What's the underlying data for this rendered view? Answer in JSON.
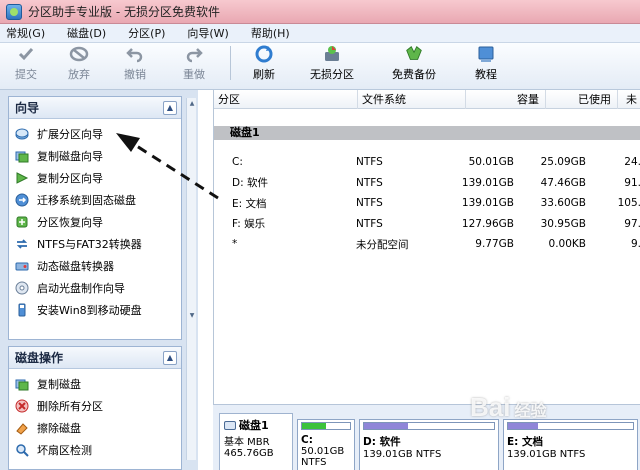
{
  "window": {
    "title": "分区助手专业版 - 无损分区免费软件"
  },
  "menu": [
    {
      "label": "常规(G)"
    },
    {
      "label": "磁盘(D)"
    },
    {
      "label": "分区(P)"
    },
    {
      "label": "向导(W)"
    },
    {
      "label": "帮助(H)"
    }
  ],
  "toolbar": {
    "submit": "提交",
    "discard": "放弃",
    "undo": "撤销",
    "redo": "重做",
    "refresh": "刷新",
    "lossless": "无损分区",
    "backup": "免费备份",
    "tutorial": "教程"
  },
  "wizard_panel": {
    "title": "向导",
    "items": [
      {
        "label": "扩展分区向导",
        "icon": "expand-partition-icon"
      },
      {
        "label": "复制磁盘向导",
        "icon": "copy-disk-icon"
      },
      {
        "label": "复制分区向导",
        "icon": "copy-partition-icon"
      },
      {
        "label": "迁移系统到固态磁盘",
        "icon": "migrate-ssd-icon"
      },
      {
        "label": "分区恢复向导",
        "icon": "recovery-icon"
      },
      {
        "label": "NTFS与FAT32转换器",
        "icon": "convert-icon"
      },
      {
        "label": "动态磁盘转换器",
        "icon": "dynamic-disk-icon"
      },
      {
        "label": "启动光盘制作向导",
        "icon": "boot-cd-icon"
      },
      {
        "label": "安装Win8到移动硬盘",
        "icon": "win8-usb-icon"
      }
    ]
  },
  "disk_ops_panel": {
    "title": "磁盘操作",
    "items": [
      {
        "label": "复制磁盘",
        "icon": "copy-disk-icon"
      },
      {
        "label": "删除所有分区",
        "icon": "delete-all-icon"
      },
      {
        "label": "擦除磁盘",
        "icon": "wipe-disk-icon"
      },
      {
        "label": "坏扇区检测",
        "icon": "bad-sector-icon"
      }
    ]
  },
  "table": {
    "columns": [
      "分区",
      "文件系统",
      "容量",
      "已使用",
      "未"
    ],
    "disk_label": "磁盘1",
    "rows": [
      {
        "partition": "C:",
        "fs": "NTFS",
        "capacity": "50.01GB",
        "used": "25.09GB",
        "free": "24."
      },
      {
        "partition": "D: 软件",
        "fs": "NTFS",
        "capacity": "139.01GB",
        "used": "47.46GB",
        "free": "91."
      },
      {
        "partition": "E: 文档",
        "fs": "NTFS",
        "capacity": "139.01GB",
        "used": "33.60GB",
        "free": "105."
      },
      {
        "partition": "F: 娱乐",
        "fs": "NTFS",
        "capacity": "127.96GB",
        "used": "30.95GB",
        "free": "97."
      },
      {
        "partition": "*",
        "fs": "未分配空间",
        "capacity": "9.77GB",
        "used": "0.00KB",
        "free": "9."
      }
    ]
  },
  "disk_map": {
    "disk": {
      "name": "磁盘1",
      "type": "基本 MBR",
      "size": "465.76GB"
    },
    "partitions": [
      {
        "name": "C:",
        "info": "50.01GB NTFS",
        "used_fraction": 0.5,
        "color": "#3cc23c"
      },
      {
        "name": "D: 软件",
        "info": "139.01GB NTFS",
        "used_fraction": 0.34,
        "color": "#8f86d8"
      },
      {
        "name": "E: 文档",
        "info": "139.01GB NTFS",
        "used_fraction": 0.24,
        "color": "#8f86d8"
      }
    ]
  },
  "watermark": {
    "text": "Bai",
    "sub": "经验"
  }
}
